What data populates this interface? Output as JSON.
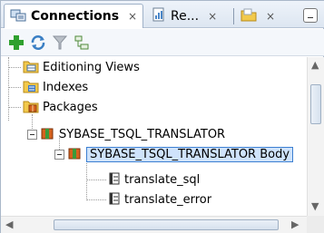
{
  "tabs": [
    {
      "label": "Connections",
      "close": "×",
      "icon": "connections-icon"
    },
    {
      "label": "Re...",
      "close": "×",
      "icon": "reports-icon"
    },
    {
      "label": "",
      "close": "×",
      "icon": "files-icon"
    }
  ],
  "toolbar": {
    "icons": [
      "add-connection-icon",
      "refresh-icon",
      "filter-icon",
      "schema-browser-icon"
    ]
  },
  "tree": {
    "items": [
      {
        "label": "Editioning Views",
        "icon": "folder-views-icon"
      },
      {
        "label": "Indexes",
        "icon": "folder-indexes-icon"
      },
      {
        "label": "Packages",
        "icon": "folder-packages-icon"
      },
      {
        "label": "SYBASE_TSQL_TRANSLATOR",
        "icon": "package-icon"
      },
      {
        "label": "SYBASE_TSQL_TRANSLATOR Body",
        "icon": "package-body-icon",
        "selected": true
      },
      {
        "label": "translate_sql",
        "icon": "procedure-icon"
      },
      {
        "label": "translate_error",
        "icon": "procedure-icon"
      }
    ]
  },
  "colors": {
    "selection_bg": "#cfe3fb",
    "selection_border": "#3c7fd1",
    "add_green": "#2ea02e"
  }
}
